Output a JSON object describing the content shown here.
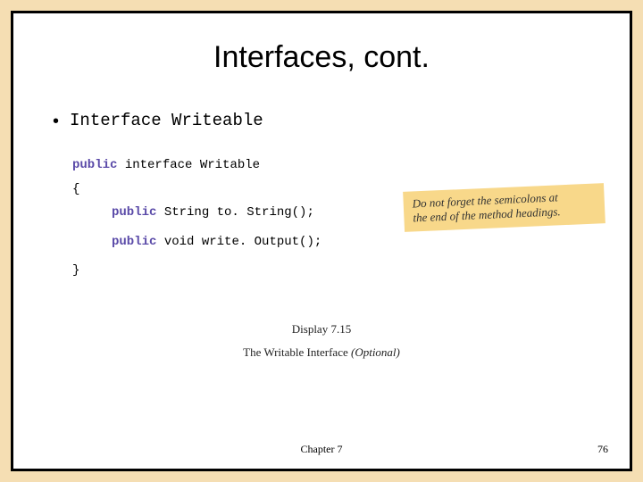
{
  "title": "Interfaces, cont.",
  "bullet": {
    "marker": "•",
    "prefix": "Interface ",
    "name": "Writeable"
  },
  "code": {
    "l1a": "public",
    "l1b": " interface ",
    "l1c": "Writable",
    "l2": "{",
    "l3a": "public",
    "l3b": " String to. String();",
    "l4a": "public",
    "l4b": " void ",
    "l4c": "write. Output();",
    "l5": "}"
  },
  "note": {
    "line1": "Do not forget the semicolons at",
    "line2": "the end of the method headings."
  },
  "caption": {
    "display": "Display 7.15",
    "main": "The Writable Interface ",
    "optional": "(Optional)"
  },
  "footer": {
    "chapter": "Chapter 7",
    "page": "76"
  }
}
